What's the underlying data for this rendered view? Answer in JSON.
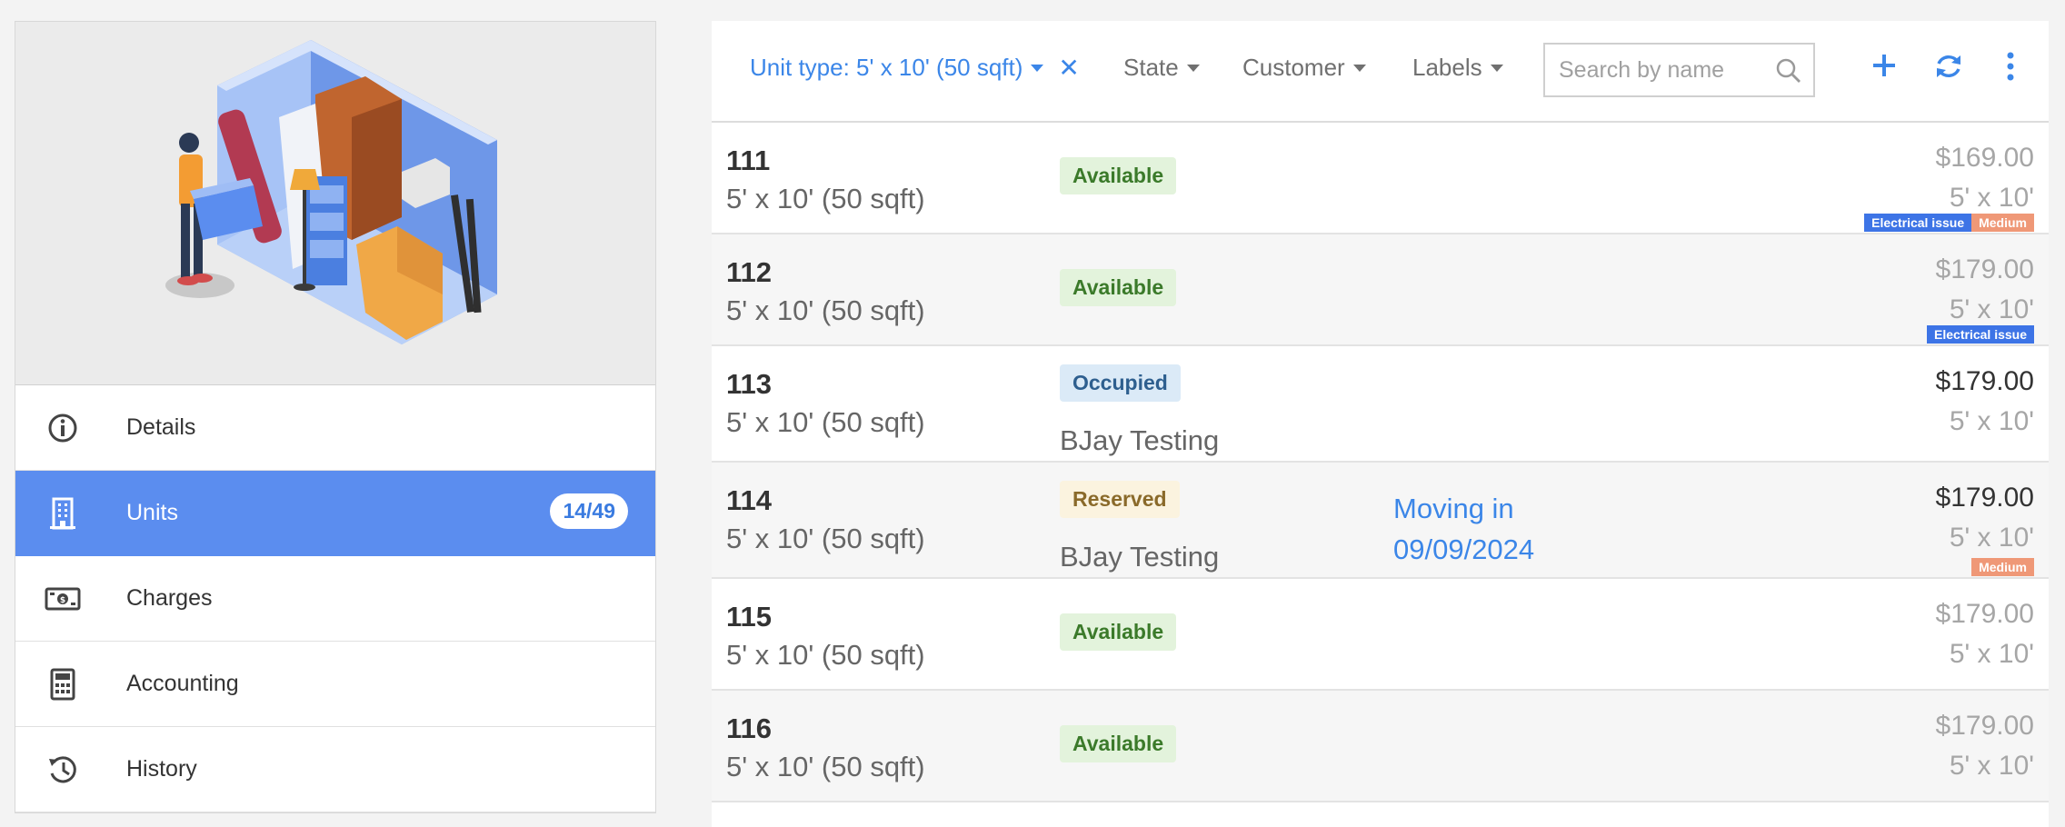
{
  "sidebar": {
    "nav": [
      {
        "label": "Details",
        "icon": "info-circle-icon"
      },
      {
        "label": "Units",
        "icon": "building-icon",
        "badge": "14/49",
        "active": true
      },
      {
        "label": "Charges",
        "icon": "money-icon"
      },
      {
        "label": "Accounting",
        "icon": "calculator-icon"
      },
      {
        "label": "History",
        "icon": "history-icon"
      }
    ]
  },
  "filters": {
    "unit_type": "Unit type: 5' x 10' (50 sqft)",
    "state": "State",
    "customer": "Customer",
    "labels": "Labels",
    "search_placeholder": "Search by name"
  },
  "colors": {
    "accent": "#3b86e8",
    "active_nav": "#5b8def",
    "electrical_tag": "#3d74e6",
    "medium_tag": "#ef9877"
  },
  "units": [
    {
      "number": "111",
      "size": "5' x 10' (50 sqft)",
      "status": "Available",
      "customer": "",
      "note": "",
      "price": "$169.00",
      "price_size": "5' x 10'",
      "tags": [
        "Electrical issue",
        "Medium"
      ]
    },
    {
      "number": "112",
      "size": "5' x 10' (50 sqft)",
      "status": "Available",
      "customer": "",
      "note": "",
      "price": "$179.00",
      "price_size": "5' x 10'",
      "tags": [
        "Electrical issue"
      ]
    },
    {
      "number": "113",
      "size": "5' x 10' (50 sqft)",
      "status": "Occupied",
      "customer": "BJay Testing",
      "note": "",
      "price": "$179.00",
      "price_size": "5' x 10'",
      "tags": []
    },
    {
      "number": "114",
      "size": "5' x 10' (50 sqft)",
      "status": "Reserved",
      "customer": "BJay Testing",
      "note_line1": "Moving in",
      "note_line2": "09/09/2024",
      "price": "$179.00",
      "price_size": "5' x 10'",
      "tags": [
        "Medium"
      ]
    },
    {
      "number": "115",
      "size": "5' x 10' (50 sqft)",
      "status": "Available",
      "customer": "",
      "note": "",
      "price": "$179.00",
      "price_size": "5' x 10'",
      "tags": []
    },
    {
      "number": "116",
      "size": "5' x 10' (50 sqft)",
      "status": "Available",
      "customer": "",
      "note": "",
      "price": "$179.00",
      "price_size": "5' x 10'",
      "tags": []
    }
  ]
}
